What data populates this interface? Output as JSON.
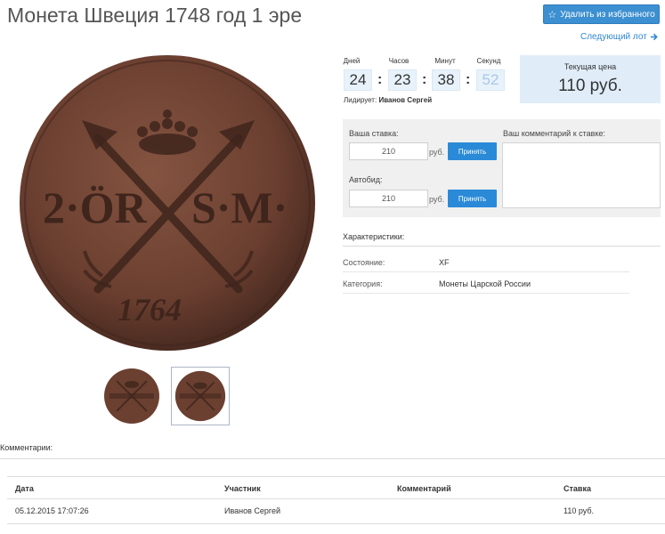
{
  "header": {
    "title": "Монета Швеция 1748 год 1 эре",
    "favorite_button": "Удалить из избранного",
    "next_lot": "Следующий лот"
  },
  "timer": {
    "labels": [
      "Дней",
      "Часов",
      "Минут",
      "Секунд"
    ],
    "values": [
      "24",
      "23",
      "38",
      "52"
    ],
    "leader_label": "Лидирует:",
    "leader_name": "Иванов Сергей"
  },
  "price": {
    "label": "Текущая цена",
    "value": "110 руб."
  },
  "bid": {
    "your_bid_label": "Ваша ставка:",
    "your_bid_value": "210",
    "currency": "руб.",
    "accept_label": "Принять",
    "autobid_label": "Автобид:",
    "autobid_value": "210",
    "comment_label": "Ваш комментарий к ставке:"
  },
  "characteristics": {
    "title": "Характеристики:",
    "rows": [
      {
        "key": "Состояние:",
        "value": "XF"
      },
      {
        "key": "Категория:",
        "value": "Монеты Царской России"
      }
    ]
  },
  "coin": {
    "legend_left": "2·ÖR",
    "legend_right": "S·M·",
    "year": "1764",
    "colors": {
      "base": "#6e4233",
      "dark": "#3d241c",
      "light": "#8a5a48"
    }
  },
  "comments": {
    "label": "Комментарии:",
    "columns": [
      "Дата",
      "Участник",
      "Комментарий",
      "Ставка"
    ],
    "rows": [
      {
        "date": "05.12.2015 17:07:26",
        "participant": "Иванов Сергей",
        "comment": "",
        "bid": "110 руб."
      }
    ]
  },
  "colors": {
    "accent": "#2b8ad8",
    "link": "#2f86d2",
    "panel": "#f0f0f0",
    "price_bg": "#e0edf9"
  }
}
